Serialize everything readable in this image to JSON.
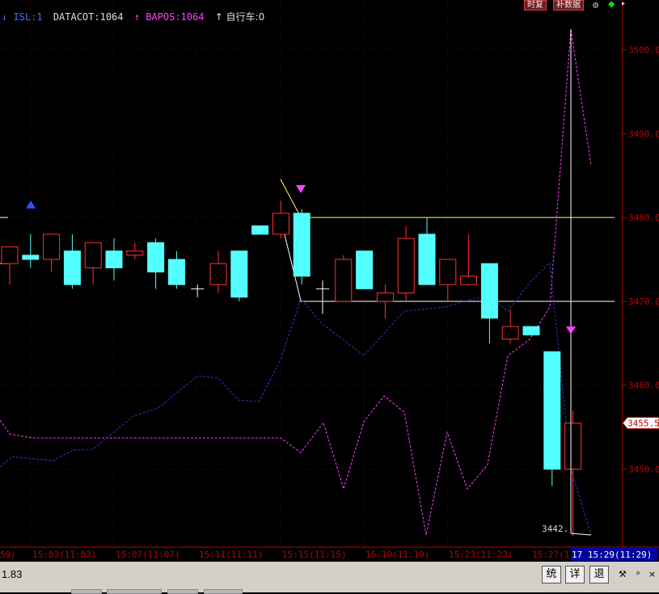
{
  "header": {
    "isl": "↓ ISL:1",
    "datacot": "DATACOT:1064",
    "bapos": "↑ BAPOS:1064",
    "self_car": "↑ 自行车:0"
  },
  "top_buttons": {
    "restore": "时复",
    "fill_data": "补数据"
  },
  "price_axis": {
    "labels": [
      "3500.0",
      "3490.0",
      "3480.0",
      "3470.0",
      "3460.0",
      "3450.0"
    ],
    "current_price": "3455.5",
    "low_label": "3442."
  },
  "time_axis": {
    "labels": [
      "59)",
      "15:03(11:03)",
      "15:07(11:07)",
      "15:11(11:11)",
      "15:15(11:15)",
      "15:19(11:19)",
      "15:23(11:23)",
      "15:27(1"
    ],
    "highlight": "17 15:29(11:29)"
  },
  "bottom_bar": {
    "value": "1.83",
    "btn_stats": "统",
    "btn_detail": "详",
    "btn_exit": "退",
    "pin": "ᵖ",
    "close": "×"
  },
  "chart_data": {
    "type": "candlestick",
    "ylim": [
      3441,
      3503
    ],
    "ticks": [
      3500,
      3490,
      3480,
      3470,
      3460,
      3450
    ],
    "candles": [
      {
        "o": 3474.5,
        "h": 3476,
        "l": 3472,
        "c": 3476.5,
        "dir": "up"
      },
      {
        "o": 3475,
        "h": 3478,
        "l": 3474,
        "c": 3475.5,
        "dir": "down"
      },
      {
        "o": 3475,
        "h": 3478,
        "l": 3473.5,
        "c": 3478,
        "dir": "up"
      },
      {
        "o": 3476,
        "h": 3478,
        "l": 3471.5,
        "c": 3472,
        "dir": "down"
      },
      {
        "o": 3474,
        "h": 3476,
        "l": 3472,
        "c": 3477,
        "dir": "up"
      },
      {
        "o": 3476,
        "h": 3477.5,
        "l": 3472.5,
        "c": 3474,
        "dir": "down"
      },
      {
        "o": 3476,
        "h": 3477,
        "l": 3475,
        "c": 3475.5,
        "dir": "up"
      },
      {
        "o": 3477,
        "h": 3477.5,
        "l": 3471.5,
        "c": 3473.5,
        "dir": "down"
      },
      {
        "o": 3475,
        "h": 3476,
        "l": 3471.5,
        "c": 3472,
        "dir": "down"
      },
      {
        "o": 3471.5,
        "h": 3472,
        "l": 3470.5,
        "c": 3471.2,
        "dir": "cross"
      },
      {
        "o": 3472,
        "h": 3476,
        "l": 3471,
        "c": 3474.5,
        "dir": "up"
      },
      {
        "o": 3476,
        "h": 3476,
        "l": 3470,
        "c": 3470.5,
        "dir": "down"
      },
      {
        "o": 3479,
        "h": 3479,
        "l": 3478,
        "c": 3478,
        "dir": "down"
      },
      {
        "o": 3478,
        "h": 3482,
        "l": 3477.5,
        "c": 3480.5,
        "dir": "up"
      },
      {
        "o": 3480.5,
        "h": 3481,
        "l": 3472,
        "c": 3473,
        "dir": "down"
      },
      {
        "o": 3471.5,
        "h": 3472.5,
        "l": 3468.5,
        "c": 3471.5,
        "dir": "cross"
      },
      {
        "o": 3470,
        "h": 3475.5,
        "l": 3470,
        "c": 3475,
        "dir": "up"
      },
      {
        "o": 3476,
        "h": 3476,
        "l": 3471.5,
        "c": 3471.5,
        "dir": "down"
      },
      {
        "o": 3470,
        "h": 3472,
        "l": 3468,
        "c": 3471,
        "dir": "up"
      },
      {
        "o": 3471,
        "h": 3479,
        "l": 3470,
        "c": 3477.5,
        "dir": "up"
      },
      {
        "o": 3478,
        "h": 3480,
        "l": 3472,
        "c": 3472,
        "dir": "down"
      },
      {
        "o": 3472,
        "h": 3475,
        "l": 3470,
        "c": 3475,
        "dir": "up"
      },
      {
        "o": 3472,
        "h": 3478,
        "l": 3472,
        "c": 3473,
        "dir": "up"
      },
      {
        "o": 3474.5,
        "h": 3474.5,
        "l": 3465,
        "c": 3468,
        "dir": "down"
      },
      {
        "o": 3465.5,
        "h": 3469,
        "l": 3465,
        "c": 3467,
        "dir": "up"
      },
      {
        "o": 3467,
        "h": 3467,
        "l": 3466,
        "c": 3466,
        "dir": "down"
      },
      {
        "o": 3464,
        "h": 3464,
        "l": 3448,
        "c": 3450,
        "dir": "down"
      },
      {
        "o": 3450,
        "h": 3457,
        "l": 3442,
        "c": 3455.5,
        "dir": "up"
      }
    ],
    "ref_lines": [
      3480,
      3470
    ]
  }
}
